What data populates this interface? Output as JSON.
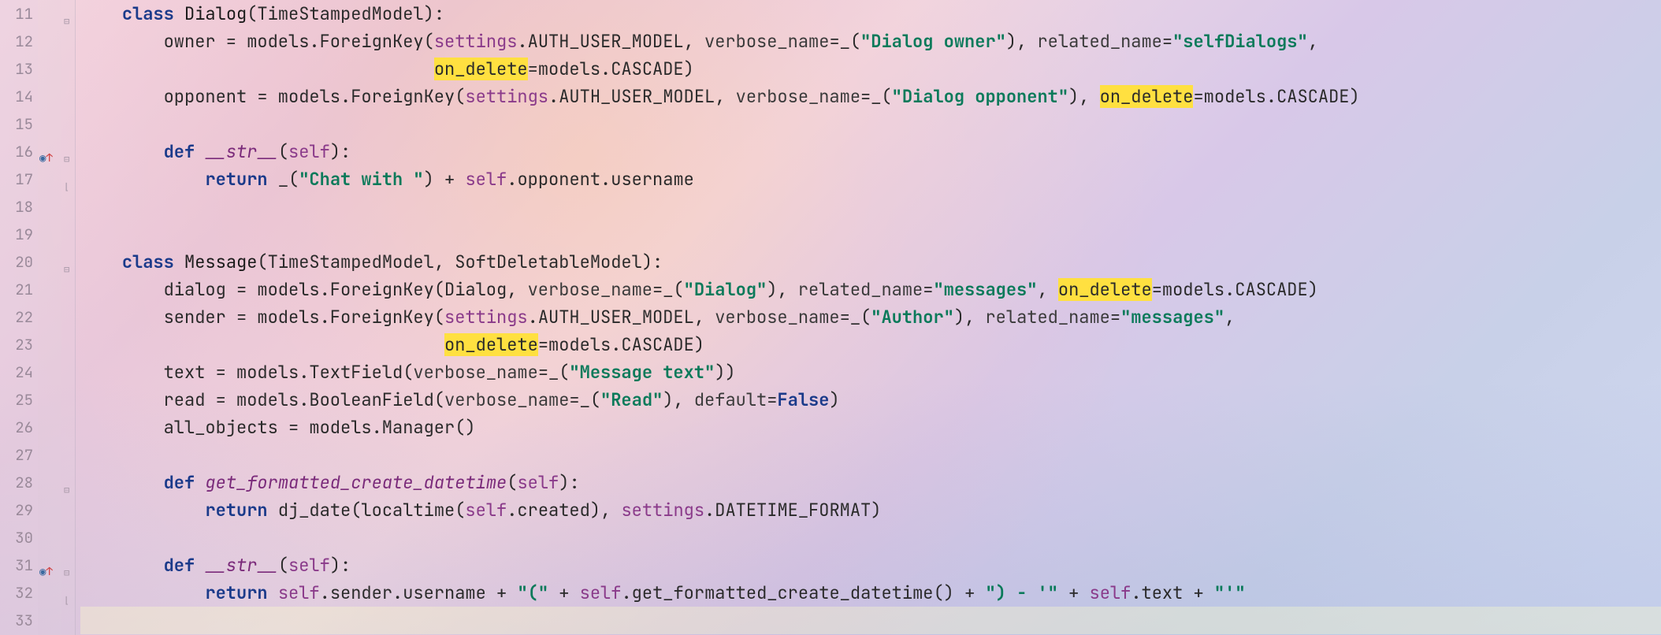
{
  "lines": {
    "start": 11,
    "end": 33
  },
  "override_markers": [
    16,
    31
  ],
  "code": {
    "11": [
      {
        "t": "    ",
        "c": ""
      },
      {
        "t": "class ",
        "c": "kw"
      },
      {
        "t": "Dialog",
        "c": "cls"
      },
      {
        "t": "(TimeStampedModel):",
        "c": "punct"
      }
    ],
    "12": [
      {
        "t": "        owner = models.ForeignKey(",
        "c": ""
      },
      {
        "t": "settings",
        "c": "selfc"
      },
      {
        "t": ".AUTH_USER_MODEL, ",
        "c": ""
      },
      {
        "t": "verbose_name",
        "c": "kwarg"
      },
      {
        "t": "=_(",
        "c": ""
      },
      {
        "t": "\"Dialog owner\"",
        "c": "str"
      },
      {
        "t": "), ",
        "c": ""
      },
      {
        "t": "related_name",
        "c": "kwarg"
      },
      {
        "t": "=",
        "c": ""
      },
      {
        "t": "\"selfDialogs\"",
        "c": "str"
      },
      {
        "t": ",",
        "c": ""
      }
    ],
    "13": [
      {
        "t": "                                  ",
        "c": ""
      },
      {
        "t": "on_delete",
        "c": "hl"
      },
      {
        "t": "=models.CASCADE)",
        "c": ""
      }
    ],
    "14": [
      {
        "t": "        opponent = models.ForeignKey(",
        "c": ""
      },
      {
        "t": "settings",
        "c": "selfc"
      },
      {
        "t": ".AUTH_USER_MODEL, ",
        "c": ""
      },
      {
        "t": "verbose_name",
        "c": "kwarg"
      },
      {
        "t": "=_(",
        "c": ""
      },
      {
        "t": "\"Dialog opponent\"",
        "c": "str"
      },
      {
        "t": "), ",
        "c": ""
      },
      {
        "t": "on_delete",
        "c": "hl"
      },
      {
        "t": "=models.CASCADE)",
        "c": ""
      }
    ],
    "15": [
      {
        "t": "",
        "c": ""
      }
    ],
    "16": [
      {
        "t": "        ",
        "c": ""
      },
      {
        "t": "def ",
        "c": "kw"
      },
      {
        "t": "__str__",
        "c": "dunder"
      },
      {
        "t": "(",
        "c": ""
      },
      {
        "t": "self",
        "c": "selfc"
      },
      {
        "t": "):",
        "c": ""
      }
    ],
    "17": [
      {
        "t": "            ",
        "c": ""
      },
      {
        "t": "return ",
        "c": "kw"
      },
      {
        "t": "_(",
        "c": ""
      },
      {
        "t": "\"Chat with \"",
        "c": "str"
      },
      {
        "t": ") + ",
        "c": ""
      },
      {
        "t": "self",
        "c": "selfc"
      },
      {
        "t": ".opponent.username",
        "c": ""
      }
    ],
    "18": [
      {
        "t": "",
        "c": ""
      }
    ],
    "19": [
      {
        "t": "",
        "c": ""
      }
    ],
    "20": [
      {
        "t": "    ",
        "c": ""
      },
      {
        "t": "class ",
        "c": "kw"
      },
      {
        "t": "Message",
        "c": "cls"
      },
      {
        "t": "(TimeStampedModel, SoftDeletableModel):",
        "c": ""
      }
    ],
    "21": [
      {
        "t": "        dialog = models.ForeignKey(Dialog, ",
        "c": ""
      },
      {
        "t": "verbose_name",
        "c": "kwarg"
      },
      {
        "t": "=_(",
        "c": ""
      },
      {
        "t": "\"Dialog\"",
        "c": "str"
      },
      {
        "t": "), ",
        "c": ""
      },
      {
        "t": "related_name",
        "c": "kwarg"
      },
      {
        "t": "=",
        "c": ""
      },
      {
        "t": "\"messages\"",
        "c": "str"
      },
      {
        "t": ", ",
        "c": ""
      },
      {
        "t": "on_delete",
        "c": "hl"
      },
      {
        "t": "=models.CASCADE)",
        "c": ""
      }
    ],
    "22": [
      {
        "t": "        sender = models.ForeignKey(",
        "c": ""
      },
      {
        "t": "settings",
        "c": "selfc"
      },
      {
        "t": ".AUTH_USER_MODEL, ",
        "c": ""
      },
      {
        "t": "verbose_name",
        "c": "kwarg"
      },
      {
        "t": "=_(",
        "c": ""
      },
      {
        "t": "\"Author\"",
        "c": "str"
      },
      {
        "t": "), ",
        "c": ""
      },
      {
        "t": "related_name",
        "c": "kwarg"
      },
      {
        "t": "=",
        "c": ""
      },
      {
        "t": "\"messages\"",
        "c": "str"
      },
      {
        "t": ",",
        "c": ""
      }
    ],
    "23": [
      {
        "t": "                                   ",
        "c": ""
      },
      {
        "t": "on_delete",
        "c": "hl"
      },
      {
        "t": "=models.CASCADE)",
        "c": ""
      }
    ],
    "24": [
      {
        "t": "        text = models.TextField(",
        "c": ""
      },
      {
        "t": "verbose_name",
        "c": "kwarg"
      },
      {
        "t": "=_(",
        "c": ""
      },
      {
        "t": "\"Message text\"",
        "c": "str"
      },
      {
        "t": "))",
        "c": ""
      }
    ],
    "25": [
      {
        "t": "        read = models.BooleanField(",
        "c": ""
      },
      {
        "t": "verbose_name",
        "c": "kwarg"
      },
      {
        "t": "=_(",
        "c": ""
      },
      {
        "t": "\"Read\"",
        "c": "str"
      },
      {
        "t": "), ",
        "c": ""
      },
      {
        "t": "default",
        "c": "kwarg"
      },
      {
        "t": "=",
        "c": ""
      },
      {
        "t": "False",
        "c": "kw"
      },
      {
        "t": ")",
        "c": ""
      }
    ],
    "26": [
      {
        "t": "        all_objects = models.Manager()",
        "c": ""
      }
    ],
    "27": [
      {
        "t": "",
        "c": ""
      }
    ],
    "28": [
      {
        "t": "        ",
        "c": ""
      },
      {
        "t": "def ",
        "c": "kw"
      },
      {
        "t": "get_formatted_create_datetime",
        "c": "fn"
      },
      {
        "t": "(",
        "c": ""
      },
      {
        "t": "self",
        "c": "selfc"
      },
      {
        "t": "):",
        "c": ""
      }
    ],
    "29": [
      {
        "t": "            ",
        "c": ""
      },
      {
        "t": "return ",
        "c": "kw"
      },
      {
        "t": "dj_date(localtime(",
        "c": ""
      },
      {
        "t": "self",
        "c": "selfc"
      },
      {
        "t": ".created), ",
        "c": ""
      },
      {
        "t": "settings",
        "c": "selfc"
      },
      {
        "t": ".DATETIME_FORMAT)",
        "c": ""
      }
    ],
    "30": [
      {
        "t": "",
        "c": ""
      }
    ],
    "31": [
      {
        "t": "        ",
        "c": ""
      },
      {
        "t": "def ",
        "c": "kw"
      },
      {
        "t": "__str__",
        "c": "dunder"
      },
      {
        "t": "(",
        "c": ""
      },
      {
        "t": "self",
        "c": "selfc"
      },
      {
        "t": "):",
        "c": ""
      }
    ],
    "32": [
      {
        "t": "            ",
        "c": ""
      },
      {
        "t": "return ",
        "c": "kw"
      },
      {
        "t": "self",
        "c": "selfc"
      },
      {
        "t": ".sender.username + ",
        "c": ""
      },
      {
        "t": "\"(\"",
        "c": "str"
      },
      {
        "t": " + ",
        "c": ""
      },
      {
        "t": "self",
        "c": "selfc"
      },
      {
        "t": ".get_formatted_create_datetime() + ",
        "c": ""
      },
      {
        "t": "\") - '\"",
        "c": "str"
      },
      {
        "t": " + ",
        "c": ""
      },
      {
        "t": "self",
        "c": "selfc"
      },
      {
        "t": ".text + ",
        "c": ""
      },
      {
        "t": "\"'\"",
        "c": "str"
      }
    ],
    "33": [
      {
        "t": "",
        "c": ""
      }
    ]
  }
}
